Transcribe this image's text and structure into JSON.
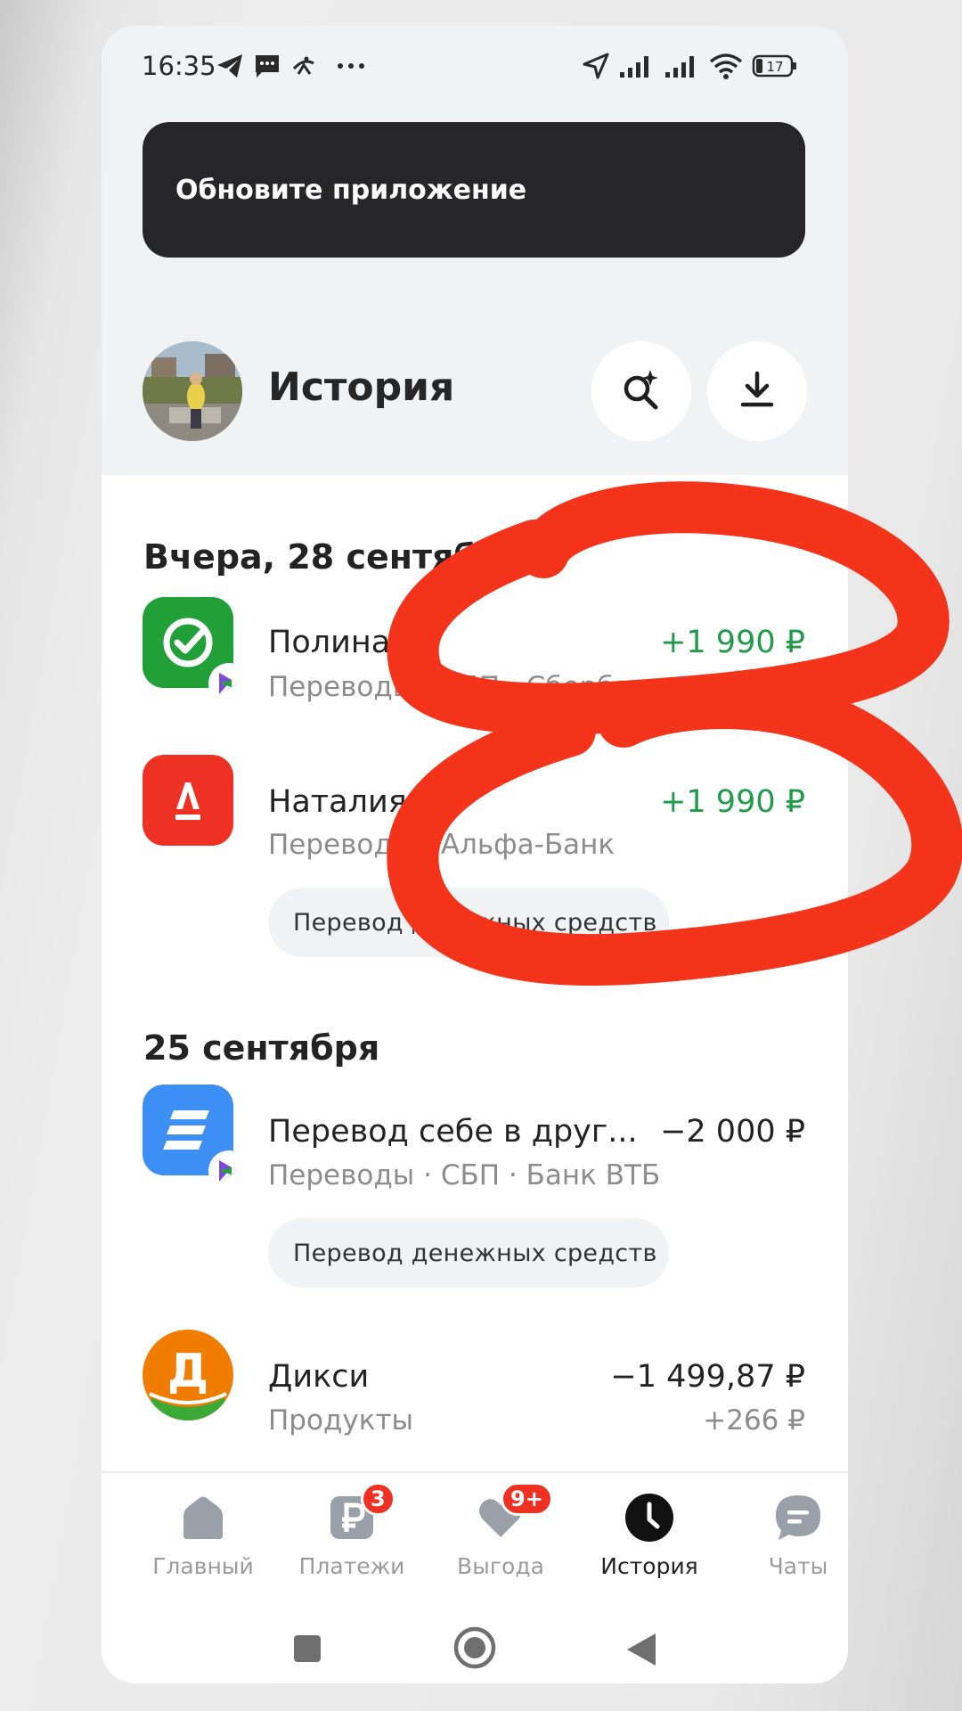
{
  "status_bar": {
    "time": "16:35",
    "battery": "17",
    "icons": [
      "telegram-icon",
      "message-icon",
      "app-icon",
      "more-icon",
      "location-icon",
      "signal-icon",
      "signal-icon",
      "wifi-icon",
      "battery-icon"
    ]
  },
  "banner": {
    "text": "Обновите приложение"
  },
  "header": {
    "title": "История",
    "search_icon": "search-sparkle-icon",
    "download_icon": "download-icon"
  },
  "sections": [
    {
      "title": "Вчера, 28 сентября",
      "operations": [
        {
          "icon": "sberbank-icon",
          "icon_color": "#21a038",
          "title": "Полина Т.",
          "subtitle": "Переводы · СБП · Сбербанк",
          "amount": "+1 990 ₽",
          "amount_color": "#229a4c"
        },
        {
          "icon": "alfa-bank-icon",
          "icon_color": "#ef3124",
          "title": "Наталия Б.",
          "subtitle": "Переводы · Альфа-Банк",
          "amount": "+1 990 ₽",
          "amount_color": "#229a4c",
          "chip": "Перевод денежных средств"
        }
      ]
    },
    {
      "title": "25 сентября",
      "operations": [
        {
          "icon": "vtb-icon",
          "icon_color": "#3d8ff5",
          "title": "Перевод себе в друг...",
          "subtitle": "Переводы · СБП · Банк ВТБ",
          "amount": "−2 000 ₽",
          "chip": "Перевод денежных средств"
        },
        {
          "icon": "dixy-icon",
          "icon_color": "#f07d00",
          "icon_letter": "Д",
          "title": "Дикси",
          "subtitle": "Продукты",
          "amount": "−1 499,87 ₽",
          "cashback": "+266 ₽"
        }
      ]
    }
  ],
  "nav": [
    {
      "label": "Главный",
      "icon": "home-icon"
    },
    {
      "label": "Платежи",
      "icon": "payments-icon",
      "badge": "3"
    },
    {
      "label": "Выгода",
      "icon": "heart-icon",
      "badge": "9+"
    },
    {
      "label": "История",
      "icon": "history-clock-icon",
      "active": true
    },
    {
      "label": "Чаты",
      "icon": "chat-icon"
    }
  ],
  "system_nav": [
    "recents-icon",
    "home-circle-icon",
    "back-icon"
  ],
  "accent_colors": {
    "positive": "#229a4c",
    "badge": "#ef3124",
    "scribble": "#f3341a"
  }
}
